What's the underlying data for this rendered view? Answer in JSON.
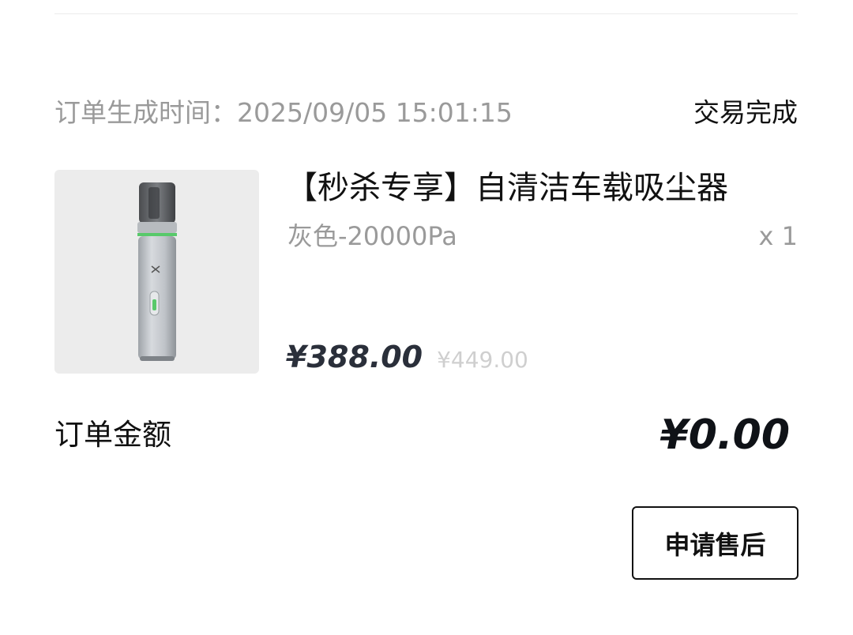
{
  "order": {
    "time_label": "订单生成时间：",
    "time_value": "2025/09/05 15:01:15",
    "status": "交易完成"
  },
  "product": {
    "image_icon": "vacuum-cleaner-image",
    "title": "【秒杀专享】自清洁车载吸尘器",
    "variant": "灰色-20000Pa",
    "quantity": "x 1",
    "price": "¥388.00",
    "original_price": "¥449.00"
  },
  "summary": {
    "amount_label": "订单金额",
    "amount_value": "¥0.00"
  },
  "actions": {
    "after_sale_label": "申请售后"
  },
  "colors": {
    "accent_green": "#58c96a",
    "muted_text": "#9a9a9a",
    "strike_price": "#cfcfcf"
  }
}
